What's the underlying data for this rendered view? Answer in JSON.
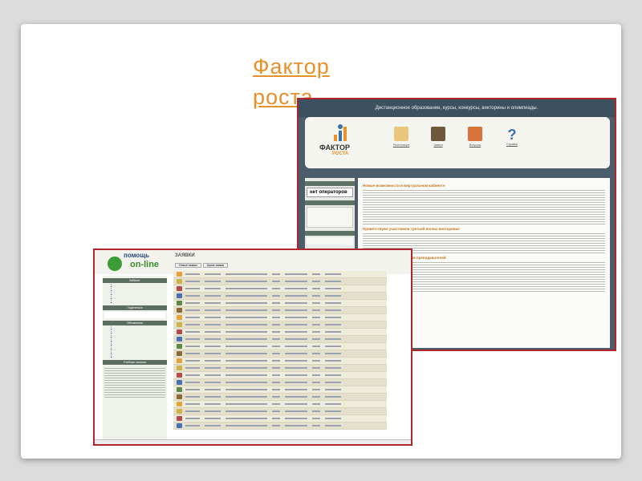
{
  "slide": {
    "title": "Фактор роста"
  },
  "front_screenshot": {
    "header": "Дистанционное образование, курсы, конкурсы, викторины и олимпиады.",
    "logo_name": "ФАКТОР",
    "logo_sub": "РОСТА",
    "nav": [
      "Регистрация",
      "Заявки",
      "Вопросы",
      "Справка"
    ],
    "operators_status": "нет операторов",
    "articles": [
      "Новые возможности в виртуальном кабинете",
      "Приветствуем участников третьей волны викторины!",
      "Третья волна викторины для преподавателей"
    ]
  },
  "back_screenshot": {
    "logo_line1": "помощь",
    "logo_line2": "on-line",
    "page_title": "ЗАЯВКИ",
    "tabs": [
      "Новые заявки",
      "Архив заявок"
    ],
    "sidebar_sections": [
      "Кабинет",
      "Поделиться",
      "Обновления",
      "Учебные занятия"
    ]
  },
  "colors": {
    "accent": "#e8902a",
    "frame": "#b1252f"
  }
}
